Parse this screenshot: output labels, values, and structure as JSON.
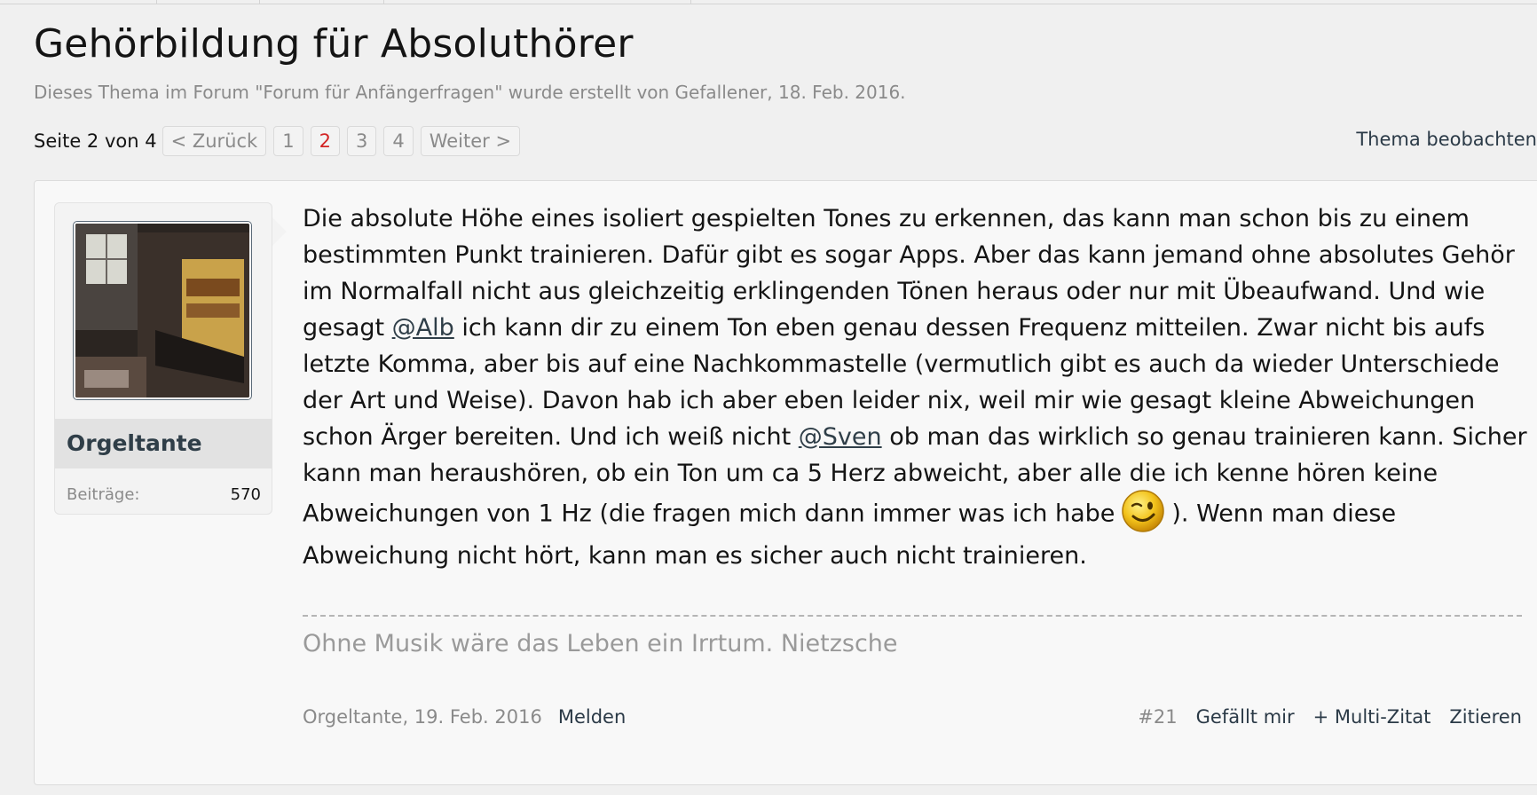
{
  "thread": {
    "title": "Gehörbildung für Absoluthörer",
    "subtitle": "Dieses Thema im Forum \"Forum für Anfängerfragen\" wurde erstellt von Gefallener, 18. Feb. 2016."
  },
  "pagination": {
    "label": "Seite 2 von 4",
    "prev": "< Zurück",
    "pages": [
      "1",
      "2",
      "3",
      "4"
    ],
    "current": "2",
    "next": "Weiter >"
  },
  "watch_label": "Thema beobachten",
  "post": {
    "user": {
      "name": "Orgeltante",
      "stat_label": "Beiträge:",
      "stat_value": "570"
    },
    "message": {
      "part1": "Die absolute Höhe eines isoliert gespielten Tones zu erkennen, das kann man schon bis zu einem bestimmten Punkt trainieren. Dafür gibt es sogar Apps. Aber das kann jemand ohne absolutes Gehör im Normalfall nicht aus gleichzeitig erklingenden Tönen heraus oder nur mit Übeaufwand. Und wie gesagt ",
      "mention1": "@Alb",
      "part2": " ich kann dir zu einem Ton eben genau dessen Frequenz mitteilen. Zwar nicht bis aufs letzte Komma, aber bis auf eine Nachkommastelle (vermutlich gibt es auch da wieder Unterschiede der Art und Weise). Davon hab ich aber eben leider nix, weil mir wie gesagt kleine Abweichungen schon Ärger bereiten. Und ich weiß nicht ",
      "mention2": "@Sven",
      "part3": " ob man das wirklich so genau trainieren kann. Sicher kann man heraushören, ob ein Ton um ca 5 Herz abweicht, aber alle die ich kenne hören keine Abweichungen von 1 Hz (die fragen mich dann immer was ich habe",
      "part4": "). Wenn man diese Abweichung nicht hört, kann man es sicher auch nicht trainieren."
    },
    "signature": "Ohne Musik wäre das Leben ein Irrtum. Nietzsche",
    "meta": "Orgeltante, 19. Feb. 2016",
    "report": "Melden",
    "number": "#21",
    "like": "Gefällt mir",
    "multiquote": "+ Multi-Zitat",
    "quote": "Zitieren"
  },
  "colors": {
    "background": "#f0f0f0",
    "current_page": "#d32323",
    "link": "#2f3e48"
  },
  "icons": {
    "smiley": "wink-smiley-icon"
  }
}
